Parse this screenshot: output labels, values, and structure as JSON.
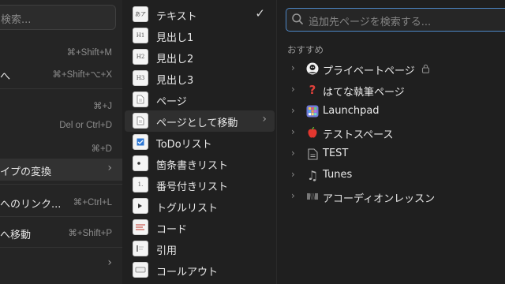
{
  "left_menu": {
    "search_placeholder": "検索...",
    "items": [
      {
        "label": "",
        "shortcut": "⌘+Shift+M"
      },
      {
        "label": "へ",
        "shortcut": "⌘+Shift+⌥+X"
      },
      {
        "label": "",
        "shortcut": "⌘+J"
      },
      {
        "label": "",
        "shortcut": "Del or Ctrl+D"
      },
      {
        "label": "",
        "shortcut": "⌘+D"
      },
      {
        "label": "イプの変換",
        "shortcut": ""
      },
      {
        "label": "へのリンク...",
        "shortcut": "⌘+Ctrl+L"
      },
      {
        "label": "へ移動",
        "shortcut": "⌘+Shift+P"
      },
      {
        "label": "",
        "shortcut": ""
      }
    ]
  },
  "block_menu": {
    "items": [
      {
        "thumb": "あア",
        "label": "テキスト"
      },
      {
        "thumb": "H1",
        "label": "見出し1"
      },
      {
        "thumb": "H2",
        "label": "見出し2"
      },
      {
        "thumb": "H3",
        "label": "見出し3"
      },
      {
        "thumb": "",
        "label": "ページ"
      },
      {
        "thumb": "",
        "label": "ページとして移動"
      },
      {
        "thumb": "",
        "label": "ToDoリスト"
      },
      {
        "thumb": "",
        "label": "箇条書きリスト"
      },
      {
        "thumb": "1.",
        "label": "番号付きリスト"
      },
      {
        "thumb": "",
        "label": "トグルリスト"
      },
      {
        "thumb": "",
        "label": "コード"
      },
      {
        "thumb": "",
        "label": "引用"
      },
      {
        "thumb": "",
        "label": "コールアウト"
      }
    ]
  },
  "move_panel": {
    "search_placeholder": "追加先ページを検索する...",
    "section_title": "おすすめ",
    "pages": [
      {
        "icon": "avatar-icon",
        "label": "プライベートページ",
        "locked": true
      },
      {
        "icon": "question-icon",
        "label": "はてな執筆ページ",
        "locked": false
      },
      {
        "icon": "launchpad-icon",
        "label": "Launchpad",
        "locked": false
      },
      {
        "icon": "apple-icon",
        "label": "テストスペース",
        "locked": false
      },
      {
        "icon": "page-icon",
        "label": "TEST",
        "locked": false
      },
      {
        "icon": "music-note-icon",
        "label": "Tunes",
        "locked": false
      },
      {
        "icon": "accordion-icon",
        "label": "アコーディオンレッスン",
        "locked": false
      }
    ]
  },
  "colors": {
    "accent_focus": "#4d87c6",
    "question_red": "#e0413b",
    "apple_red": "#e2372f"
  }
}
